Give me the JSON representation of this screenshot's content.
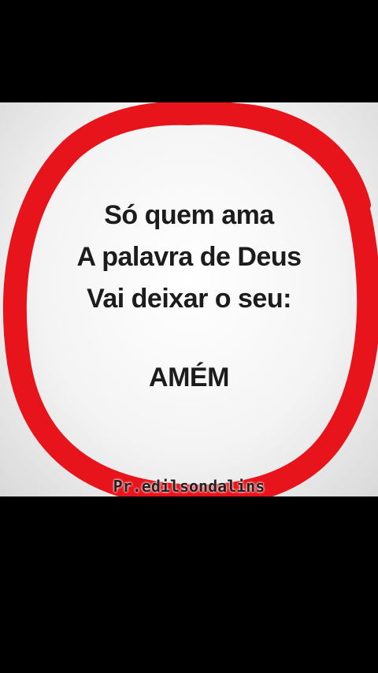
{
  "post": {
    "lines": [
      "Só quem ama",
      "A palavra de Deus",
      "Vai deixar o seu:"
    ],
    "highlight": "AMÉM",
    "signature": "Pr.edilsondalins"
  },
  "colors": {
    "ring": "#e8141b",
    "text": "#1c1c1c",
    "background": "#000000"
  }
}
